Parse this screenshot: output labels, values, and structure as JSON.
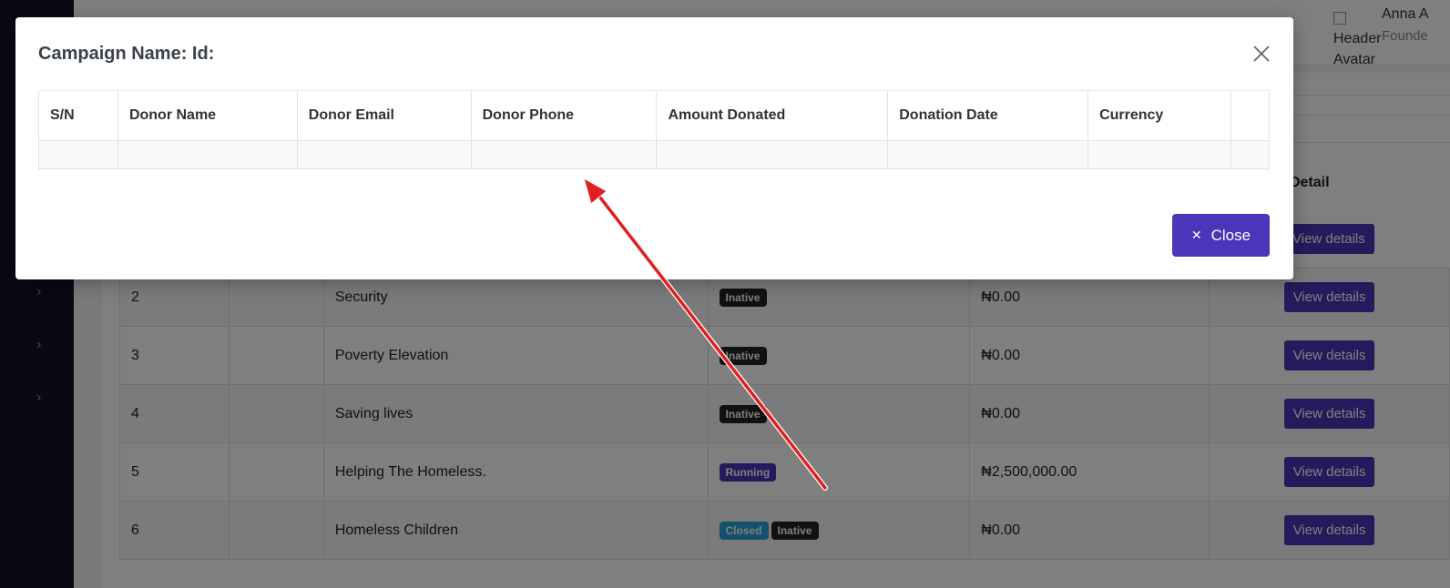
{
  "header": {
    "avatar_alt": "Header Avatar",
    "user_name": "Anna A",
    "user_role": "Founde"
  },
  "sidebar": {
    "chevron_icon": "chevron-right-icon"
  },
  "campaigns_table": {
    "detail_header": "Detail",
    "rows": [
      {
        "sn": "2",
        "name": "Security",
        "badges": [
          {
            "label": "Inative",
            "kind": "inative"
          }
        ],
        "amount": "₦0.00",
        "action": "View details"
      },
      {
        "sn": "3",
        "name": "Poverty Elevation",
        "badges": [
          {
            "label": "Inative",
            "kind": "inative"
          }
        ],
        "amount": "₦0.00",
        "action": "View details"
      },
      {
        "sn": "4",
        "name": "Saving lives",
        "badges": [
          {
            "label": "Inative",
            "kind": "inative"
          }
        ],
        "amount": "₦0.00",
        "action": "View details"
      },
      {
        "sn": "5",
        "name": "Helping The Homeless.",
        "badges": [
          {
            "label": "Running",
            "kind": "running"
          }
        ],
        "amount": "₦2,500,000.00",
        "action": "View details"
      },
      {
        "sn": "6",
        "name": "Homeless Children",
        "badges": [
          {
            "label": "Closed",
            "kind": "closed"
          },
          {
            "label": "Inative",
            "kind": "inative"
          }
        ],
        "amount": "₦0.00",
        "action": "View details"
      }
    ],
    "first_row_action": "View details"
  },
  "modal": {
    "title": "Campaign Name: Id:",
    "columns": [
      "S/N",
      "Donor Name",
      "Donor Email",
      "Donor Phone",
      "Amount Donated",
      "Donation Date",
      "Currency",
      ""
    ],
    "close_label": "Close",
    "close_icon": "close-icon"
  },
  "colors": {
    "accent": "#4c35b8",
    "annotation_arrow": "#e02020"
  }
}
